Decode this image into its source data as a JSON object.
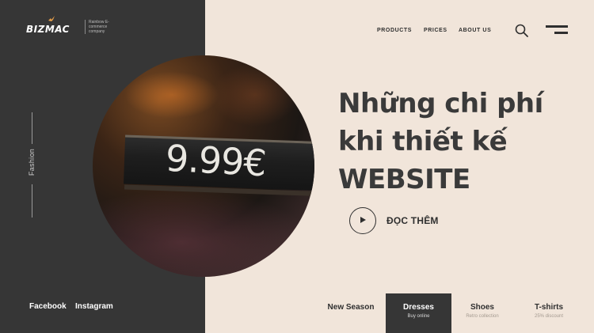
{
  "colors": {
    "dark_panel": "#363636",
    "cream_background": "#f1e5da",
    "text_dark": "#2f2f2f"
  },
  "brand": {
    "logo_text": "BIZMAC",
    "tagline": "Rainbow E-commerce company"
  },
  "sidebar": {
    "vertical_label": "Fashion"
  },
  "social": {
    "facebook": "Facebook",
    "instagram": "Instagram"
  },
  "nav": {
    "items": [
      "PRODUCTS",
      "PRICES",
      "ABOUT US"
    ],
    "search_icon": "search-icon",
    "menu_icon": "hamburger-menu-icon"
  },
  "hero": {
    "headline_lines": [
      "Những chi phí",
      "khi thiết kế",
      "WEBSITE"
    ],
    "cta_label": "ĐỌC THÊM",
    "cta_icon": "play-icon",
    "image_price_text": "9.99€"
  },
  "tabs": [
    {
      "title": "New Season",
      "subtitle": ""
    },
    {
      "title": "Dresses",
      "subtitle": "Buy online"
    },
    {
      "title": "Shoes",
      "subtitle": "Retro collection"
    },
    {
      "title": "T-shirts",
      "subtitle": "25% discount"
    }
  ]
}
